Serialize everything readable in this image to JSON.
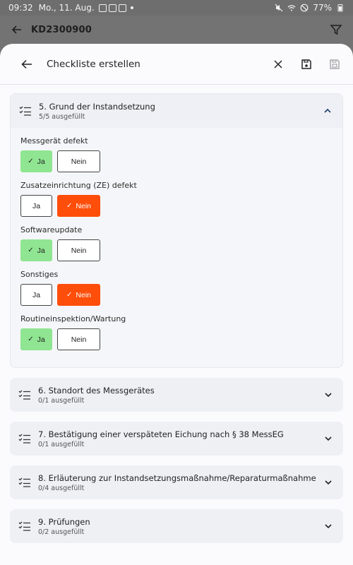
{
  "status_bar": {
    "time": "09:32",
    "date": "Mo., 11. Aug.",
    "battery": "77%"
  },
  "app_bar": {
    "title": "KD2300900"
  },
  "dialog": {
    "title": "Checkliste erstellen"
  },
  "open_section": {
    "title": "5. Grund der Instandsetzung",
    "subtitle": "5/5 ausgefüllt",
    "questions": [
      {
        "label": "Messgerät defekt",
        "yes": "Ja",
        "no": "Nein",
        "selected": "yes"
      },
      {
        "label": "Zusatzeinrichtung (ZE) defekt",
        "yes": "Ja",
        "no": "Nein",
        "selected": "no"
      },
      {
        "label": "Softwareupdate",
        "yes": "Ja",
        "no": "Nein",
        "selected": "yes"
      },
      {
        "label": "Sonstiges",
        "yes": "Ja",
        "no": "Nein",
        "selected": "no"
      },
      {
        "label": "Routineinspektion/Wartung",
        "yes": "Ja",
        "no": "Nein",
        "selected": "yes"
      }
    ]
  },
  "sections": [
    {
      "title": "6. Standort des Messgerätes",
      "subtitle": "0/1 ausgefüllt"
    },
    {
      "title": "7. Bestätigung einer verspäteten Eichung nach § 38 MessEG",
      "subtitle": "0/1 ausgefüllt"
    },
    {
      "title": "8. Erläuterung zur Instandsetzungsmaßnahme/Reparaturmaßnahme",
      "subtitle": "0/4 ausgefüllt"
    },
    {
      "title": "9. Prüfungen",
      "subtitle": "0/2 ausgefüllt"
    }
  ]
}
